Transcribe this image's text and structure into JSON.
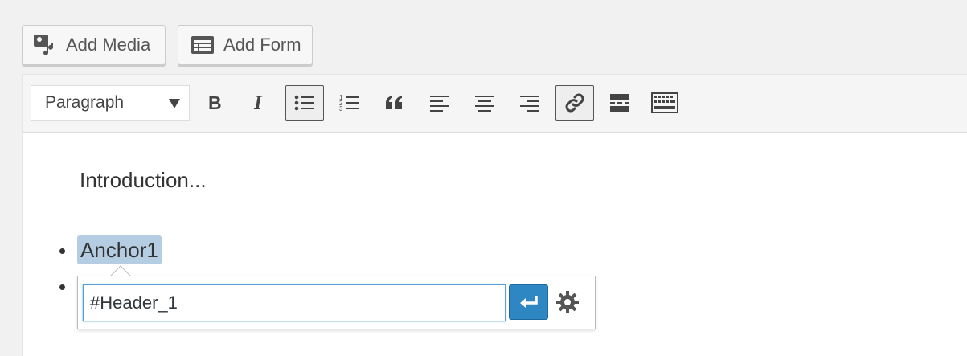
{
  "media_buttons": {
    "add_media_label": "Add Media",
    "add_form_label": "Add Form"
  },
  "toolbar": {
    "format_value": "Paragraph"
  },
  "content": {
    "intro_text": "Introduction...",
    "anchor_text": "Anchor1"
  },
  "link_popup": {
    "url_value": "#Header_1"
  },
  "colors": {
    "accent": "#2e87c2",
    "selection": "#b4cde2"
  }
}
